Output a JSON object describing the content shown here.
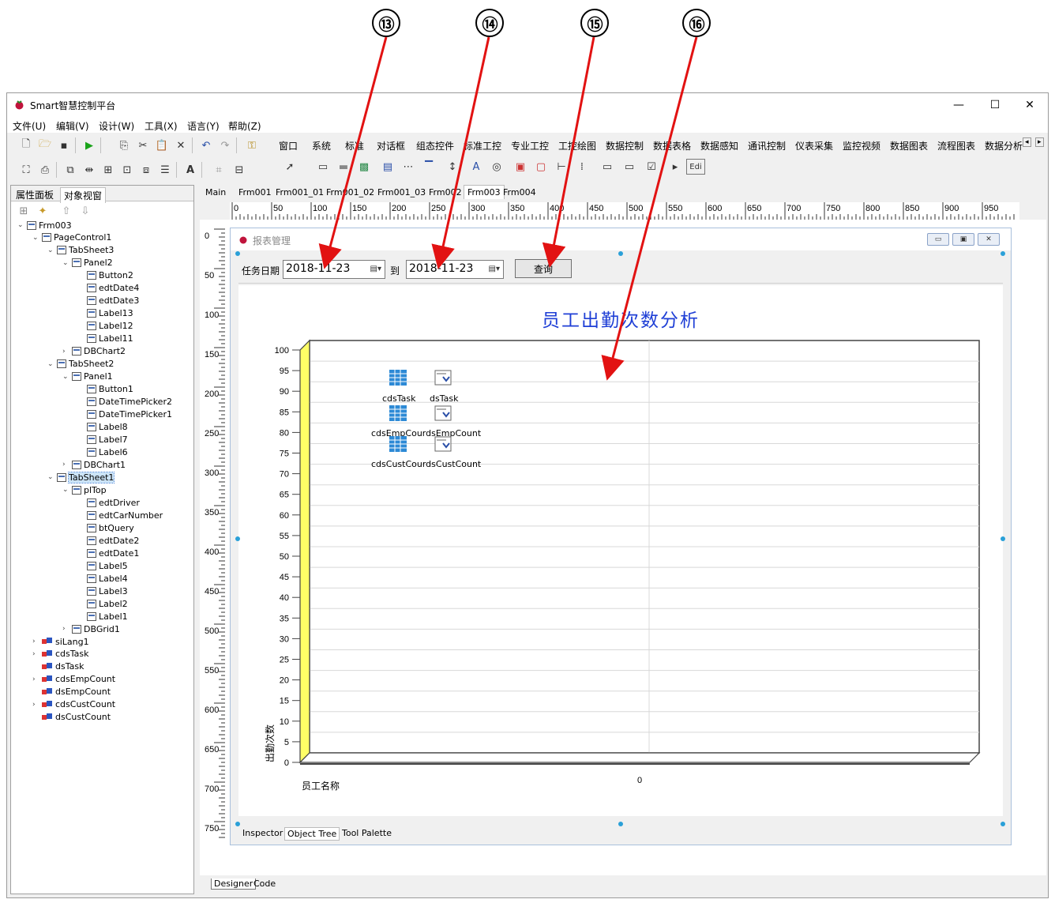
{
  "callouts": [
    "⑬",
    "⑭",
    "⑮",
    "⑯"
  ],
  "window": {
    "title": "Smart智慧控制平台",
    "minimize": "—",
    "maximize": "☐",
    "close": "✕"
  },
  "menu": [
    "文件(U)",
    "编辑(V)",
    "设计(W)",
    "工具(X)",
    "语言(Y)",
    "帮助(Z)"
  ],
  "palette_tabs": [
    "窗口",
    "系统",
    "标准",
    "对话框",
    "组态控件",
    "标准工控",
    "专业工控",
    "工控绘图",
    "数据控制",
    "数据表格",
    "数据感知",
    "通讯控制",
    "仪表采集",
    "监控视频",
    "数据图表",
    "流程图表",
    "数据分析"
  ],
  "palette_nav": [
    "◂",
    "▸"
  ],
  "palette_edit": "Edi",
  "left_tabs": [
    "属性面板",
    "对象视窗"
  ],
  "tree": [
    {
      "label": "Frm003",
      "exp": "⌄"
    },
    {
      "label": "PageControl1",
      "exp": "⌄"
    },
    {
      "label": "TabSheet3",
      "exp": "⌄"
    },
    {
      "label": "Panel2",
      "exp": "⌄"
    },
    {
      "label": "Button2",
      "exp": ""
    },
    {
      "label": "edtDate4",
      "exp": ""
    },
    {
      "label": "edtDate3",
      "exp": ""
    },
    {
      "label": "Label13",
      "exp": ""
    },
    {
      "label": "Label12",
      "exp": ""
    },
    {
      "label": "Label11",
      "exp": ""
    },
    {
      "label": "DBChart2",
      "exp": "›"
    },
    {
      "label": "TabSheet2",
      "exp": "⌄"
    },
    {
      "label": "Panel1",
      "exp": "⌄"
    },
    {
      "label": "Button1",
      "exp": ""
    },
    {
      "label": "DateTimePicker2",
      "exp": ""
    },
    {
      "label": "DateTimePicker1",
      "exp": ""
    },
    {
      "label": "Label8",
      "exp": ""
    },
    {
      "label": "Label7",
      "exp": ""
    },
    {
      "label": "Label6",
      "exp": ""
    },
    {
      "label": "DBChart1",
      "exp": "›"
    },
    {
      "label": "TabSheet1",
      "exp": "⌄"
    },
    {
      "label": "plTop",
      "exp": "⌄"
    },
    {
      "label": "edtDriver",
      "exp": ""
    },
    {
      "label": "edtCarNumber",
      "exp": ""
    },
    {
      "label": "btQuery",
      "exp": ""
    },
    {
      "label": "edtDate2",
      "exp": ""
    },
    {
      "label": "edtDate1",
      "exp": ""
    },
    {
      "label": "Label5",
      "exp": ""
    },
    {
      "label": "Label4",
      "exp": ""
    },
    {
      "label": "Label3",
      "exp": ""
    },
    {
      "label": "Label2",
      "exp": ""
    },
    {
      "label": "Label1",
      "exp": ""
    },
    {
      "label": "DBGrid1",
      "exp": "›"
    },
    {
      "label": "siLang1",
      "exp": "›"
    },
    {
      "label": "cdsTask",
      "exp": "›"
    },
    {
      "label": "dsTask",
      "exp": ""
    },
    {
      "label": "cdsEmpCount",
      "exp": "›"
    },
    {
      "label": "dsEmpCount",
      "exp": ""
    },
    {
      "label": "cdsCustCount",
      "exp": "›"
    },
    {
      "label": "dsCustCount",
      "exp": ""
    }
  ],
  "form_tabs": [
    "Main",
    "Frm001",
    "Frm001_01",
    "Frm001_02",
    "Frm001_03",
    "Frm002",
    "Frm003",
    "Frm004"
  ],
  "ruler_h": [
    "0",
    "50",
    "100",
    "150",
    "200",
    "250",
    "300",
    "350",
    "400",
    "450",
    "500",
    "550",
    "600",
    "650",
    "700",
    "750",
    "800",
    "850",
    "900",
    "950"
  ],
  "ruler_v": [
    "0",
    "50",
    "100",
    "150",
    "200",
    "250",
    "300",
    "350",
    "400",
    "450",
    "500",
    "550",
    "600",
    "650",
    "700",
    "750"
  ],
  "inner_form": {
    "title": "报表管理",
    "min": "▭",
    "restore": "▣",
    "close": "✕"
  },
  "query": {
    "label_date": "任务日期",
    "date_from": "2018-11-23",
    "label_to": "到",
    "date_to": "2018-11-23",
    "drop_icon": "▤▾",
    "button": "查询"
  },
  "components": [
    "cdsTask",
    "dsTask",
    "cdsEmpCourdsEmpCount",
    "cdsCustCourdsCustCount"
  ],
  "chart_data": {
    "type": "bar",
    "title": "员工出勤次数分析",
    "xlabel": "员工名称",
    "ylabel": "出勤次数",
    "ylim": [
      0,
      100
    ],
    "yticks": [
      0,
      5,
      10,
      15,
      20,
      25,
      30,
      35,
      40,
      45,
      50,
      55,
      60,
      65,
      70,
      75,
      80,
      85,
      90,
      95,
      100
    ],
    "x_ticks": [
      "0"
    ],
    "categories": [],
    "values": [],
    "grid": true,
    "colors": {
      "wall": "#ffff66",
      "title": "#1f3fd6",
      "grid": "#d8d8d8"
    }
  },
  "bottom_tabs": [
    "Inspector",
    "Object Tree",
    "Tool Palette"
  ],
  "designer_tabs": [
    "Designer",
    "Code"
  ]
}
